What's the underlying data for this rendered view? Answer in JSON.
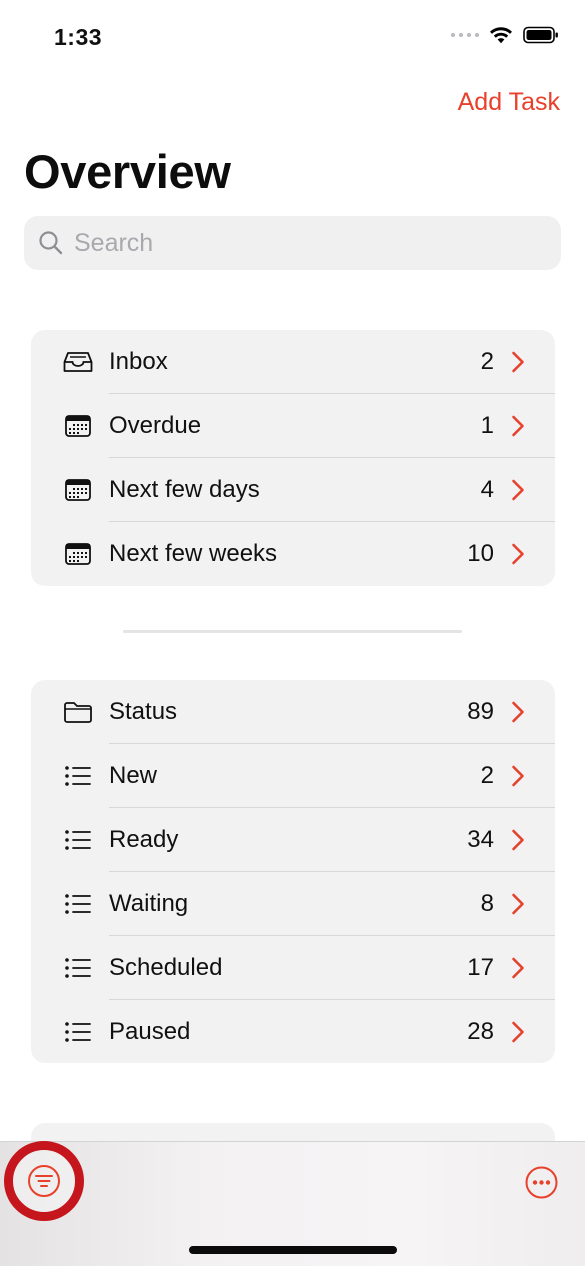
{
  "status_bar": {
    "time": "1:33"
  },
  "nav": {
    "add_task_label": "Add Task",
    "title": "Overview"
  },
  "search": {
    "placeholder": "Search",
    "value": ""
  },
  "groups": [
    {
      "items": [
        {
          "label": "Inbox",
          "count": "2",
          "icon": "inbox-icon"
        },
        {
          "label": "Overdue",
          "count": "1",
          "icon": "calendar-icon"
        },
        {
          "label": "Next few days",
          "count": "4",
          "icon": "calendar-icon"
        },
        {
          "label": "Next few weeks",
          "count": "10",
          "icon": "calendar-icon"
        }
      ]
    },
    {
      "items": [
        {
          "label": "Status",
          "count": "89",
          "icon": "folder-icon"
        },
        {
          "label": "New",
          "count": "2",
          "icon": "list-icon"
        },
        {
          "label": "Ready",
          "count": "34",
          "icon": "list-icon"
        },
        {
          "label": "Waiting",
          "count": "8",
          "icon": "list-icon"
        },
        {
          "label": "Scheduled",
          "count": "17",
          "icon": "list-icon"
        },
        {
          "label": "Paused",
          "count": "28",
          "icon": "list-icon"
        }
      ]
    }
  ],
  "toolbar": {
    "left_icon": "filter-icon",
    "right_icon": "more-icon"
  },
  "colors": {
    "accent": "#e8402a",
    "highlight_ring": "#c4161c"
  }
}
